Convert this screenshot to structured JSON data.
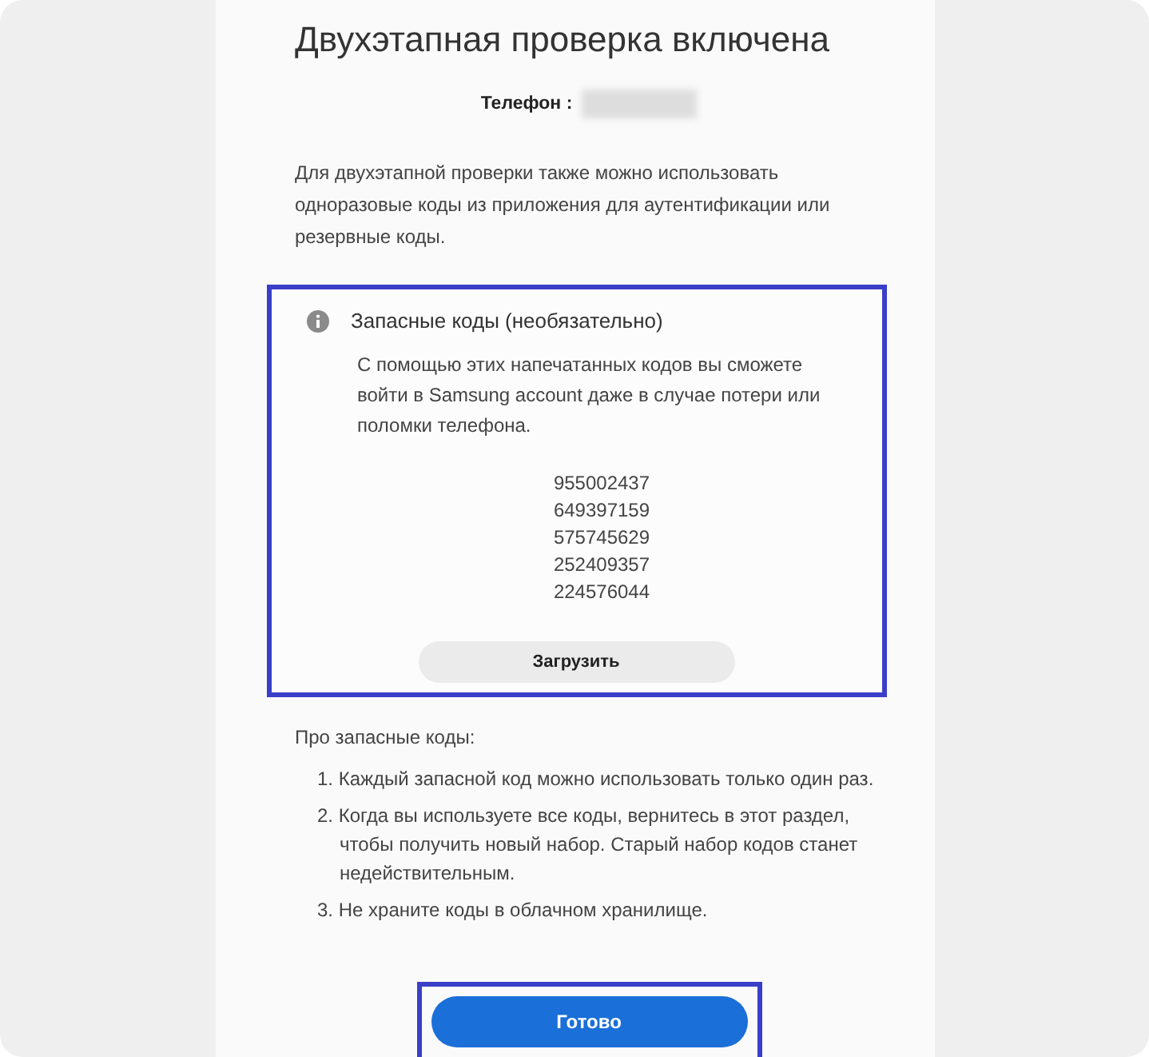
{
  "title": "Двухэтапная проверка включена",
  "phone": {
    "label": "Телефон :",
    "redacted": true
  },
  "intro": "Для двухэтапной проверки также можно использовать одноразовые коды из приложения для аутентификации или резервные коды.",
  "backup_panel": {
    "highlighted": true,
    "heading": "Запасные коды (необязательно)",
    "description": "С помощью этих напечатанных кодов вы сможете войти в Samsung account даже в случае потери или поломки телефона.",
    "codes": [
      "955002437",
      "649397159",
      "575745629",
      "252409357",
      "224576044"
    ],
    "download_button": "Загрузить"
  },
  "about": {
    "heading": "Про запасные коды:",
    "items": [
      "1. Каждый запасной код можно использовать только один раз.",
      "2. Когда вы используете все коды, вернитесь в этот раздел, чтобы получить новый набор. Старый набор кодов станет недействительным.",
      "3. Не храните коды в облачном хранилище."
    ]
  },
  "done_button": {
    "label": "Готово",
    "highlighted": true
  }
}
